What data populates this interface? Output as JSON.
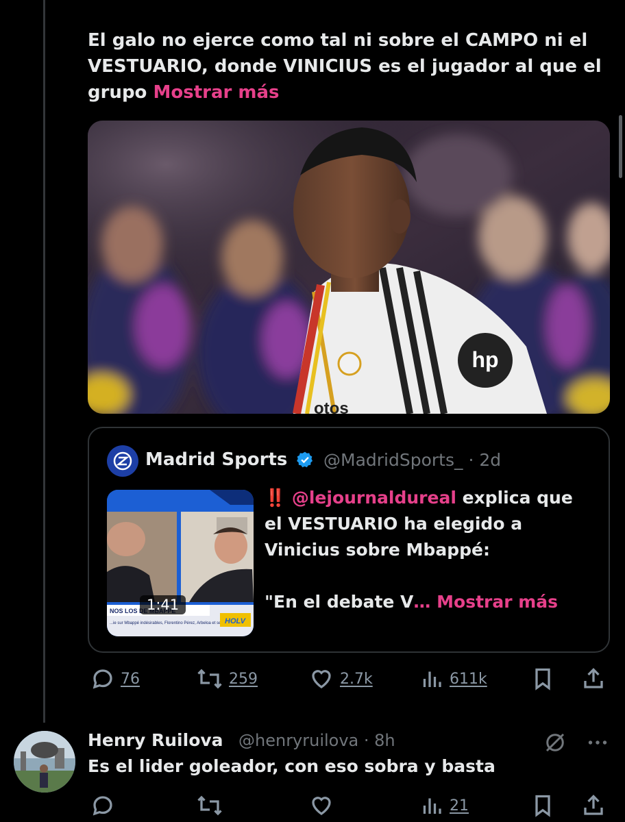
{
  "tweet": {
    "text": "El galo no ejerce como tal ni sobre el CAMPO ni el VESTUARIO, donde VINICIUS es el jugador al que el grupo",
    "show_more": "Mostrar más",
    "media_caption": "otos"
  },
  "quote": {
    "name": "Madrid Sports",
    "handle_time": "@MadridSports_ · 2d",
    "video_duration": "1:41",
    "thumb_banner": "NOS LOS DE MBAPPÉ",
    "thumb_ticker": "...ie sur Mbappé indésirables, Florentino Pérez, Arbeloa et ses coéquipiers...",
    "thumb_logo": "HOLV",
    "emoji": "‼️",
    "mention": "@lejournaldureal",
    "text_after_mention": "explica que el VESTUARIO ha elegido a Vinicius sobre Mbappé:",
    "text_truncated": "\"En el debate V",
    "ellipsis": "…",
    "show_more": "Mostrar más"
  },
  "actions": {
    "replies": "76",
    "reposts": "259",
    "likes": "2.7k",
    "views": "611k"
  },
  "reply": {
    "name": "Henry Ruilova",
    "handle_time": "@henryruilova · 8h",
    "text": "Es el lider goleador, con eso sobra y basta",
    "views": "21"
  },
  "colors": {
    "background": "#000000",
    "accent": "#e6408a",
    "text": "#e7e9ea",
    "muted": "#71767b",
    "verified": "#1d9bf0"
  }
}
